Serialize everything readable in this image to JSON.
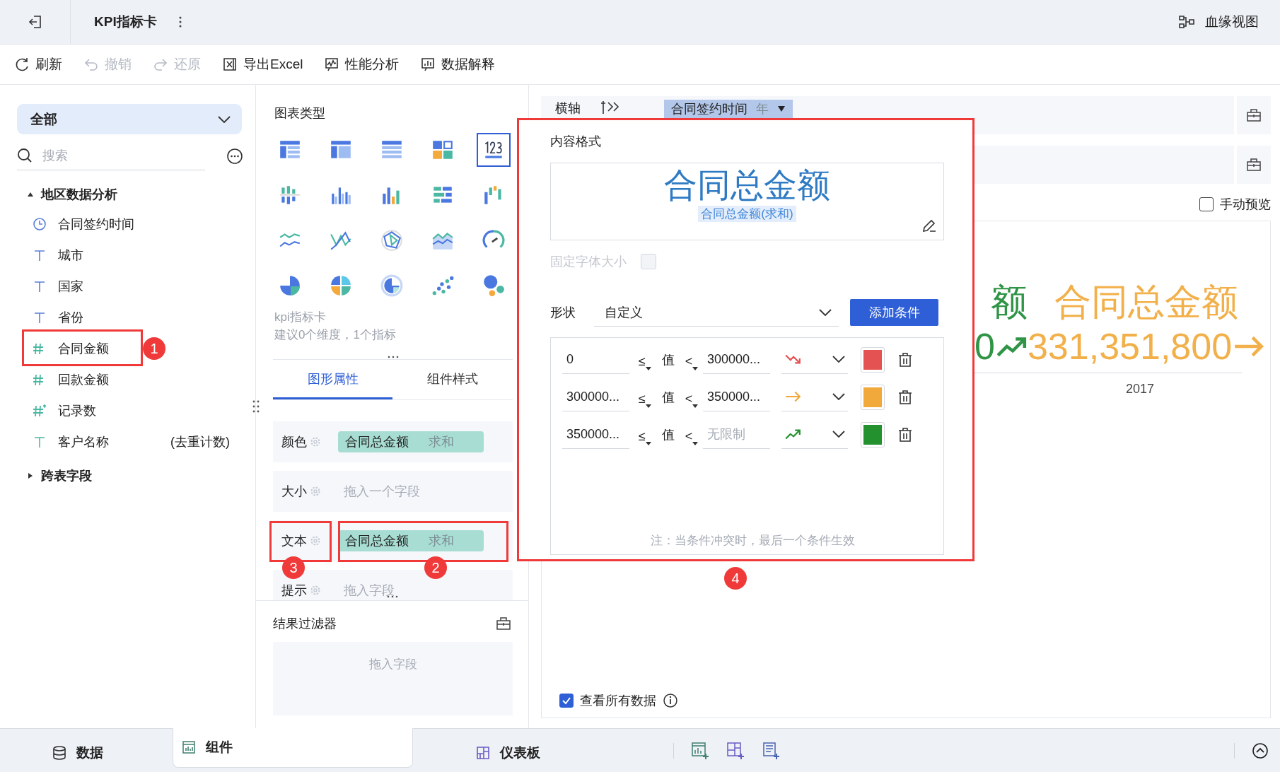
{
  "header": {
    "title": "KPI指标卡",
    "lineage_link": "血缘视图"
  },
  "toolbar": [
    {
      "kind": "refresh",
      "label": "刷新",
      "disabled": false
    },
    {
      "kind": "undo",
      "label": "撤销",
      "disabled": true
    },
    {
      "kind": "redo",
      "label": "还原",
      "disabled": true
    },
    {
      "kind": "export",
      "label": "导出Excel",
      "disabled": false
    },
    {
      "kind": "performance",
      "label": "性能分析",
      "disabled": false
    },
    {
      "kind": "explain",
      "label": "数据解释",
      "disabled": false
    }
  ],
  "data_panel": {
    "dataset_selector": "全部",
    "search": {
      "placeholder": "搜索"
    },
    "tree": [
      {
        "label": "地区数据分析",
        "expanded": true,
        "children": [
          {
            "kind": "date",
            "label": "合同签约时间"
          },
          {
            "kind": "text",
            "label": "城市"
          },
          {
            "kind": "text",
            "label": "国家"
          },
          {
            "kind": "text",
            "label": "省份"
          },
          {
            "kind": "measure",
            "label": "合同金额"
          },
          {
            "kind": "measure",
            "label": "回款金额"
          },
          {
            "kind": "count",
            "label": "记录数"
          },
          {
            "kind": "distinct",
            "label": "客户名称",
            "note": "(去重计数)"
          }
        ]
      },
      {
        "label": "跨表字段",
        "expanded": false
      }
    ]
  },
  "chart_types": {
    "title": "图表类型",
    "types": [
      {
        "kind": "table",
        "selected": false
      },
      {
        "kind": "cross-table",
        "selected": false
      },
      {
        "kind": "detail-table",
        "selected": false
      },
      {
        "kind": "block",
        "selected": false
      },
      {
        "kind": "kpi",
        "selected": true
      },
      {
        "kind": "grouped-bar",
        "selected": false
      },
      {
        "kind": "multi-bar",
        "selected": false
      },
      {
        "kind": "bar",
        "selected": false
      },
      {
        "kind": "hbar",
        "selected": false
      },
      {
        "kind": "waterfall",
        "selected": false
      },
      {
        "kind": "line",
        "selected": false
      },
      {
        "kind": "multi-line",
        "selected": false
      },
      {
        "kind": "radar",
        "selected": false
      },
      {
        "kind": "area",
        "selected": false
      },
      {
        "kind": "gauge",
        "selected": false
      },
      {
        "kind": "pie",
        "selected": false
      },
      {
        "kind": "rose",
        "selected": false
      },
      {
        "kind": "ring",
        "selected": false
      },
      {
        "kind": "scatter",
        "selected": false
      },
      {
        "kind": "bubble",
        "selected": false
      }
    ],
    "selected_name": "kpi指标卡",
    "hint": "建议0个维度，1个指标"
  },
  "property_tabs": [
    {
      "label": "图形属性",
      "selected": true
    },
    {
      "label": "组件样式",
      "selected": false
    }
  ],
  "properties": [
    {
      "label": "颜色",
      "field": "合同总金额",
      "aggregation": "求和"
    },
    {
      "label": "大小",
      "placeholder": "拖入一个字段"
    },
    {
      "label": "文本",
      "field": "合同总金额",
      "aggregation": "求和"
    },
    {
      "label": "提示",
      "placeholder": "拖入字段"
    }
  ],
  "result_filter": {
    "title": "结果过滤器",
    "placeholder": "拖入字段"
  },
  "axis_rows": [
    {
      "label": "横轴",
      "field": "合同签约时间",
      "aggregation": "年"
    }
  ],
  "manual_preview": {
    "label": "手动预览",
    "checked": false
  },
  "kpi_cards": [
    {
      "title": "额",
      "value": "0",
      "kind": "up",
      "color": "#2f9446"
    },
    {
      "title": "合同总金额",
      "value": "331,351,800",
      "kind": "flat",
      "color": "#f2b04a"
    }
  ],
  "x_axis_label": "2017",
  "view_all_data": {
    "label": "查看所有数据",
    "checked": true
  },
  "bottom_tabs": [
    {
      "kind": "data",
      "label": "数据",
      "selected": false
    },
    {
      "kind": "component",
      "label": "组件",
      "selected": true
    },
    {
      "kind": "dashboard",
      "label": "仪表板",
      "selected": false
    }
  ],
  "content_format": {
    "title": "内容格式",
    "preview_title": "合同总金额",
    "preview_field": "合同总金额(求和)",
    "fixed_font_size": {
      "label": "固定字体大小",
      "checked": false,
      "disabled": true
    },
    "shape": {
      "label": "形状",
      "value": "自定义"
    },
    "add_button": "添加条件",
    "conditions": [
      {
        "min": "0",
        "op1": "≤",
        "value_label": "值",
        "op2": "<",
        "max": "300000...",
        "kind": "down",
        "color": "#e45252"
      },
      {
        "min": "300000...",
        "op1": "≤",
        "value_label": "值",
        "op2": "<",
        "max": "350000...",
        "kind": "flat",
        "color": "#f0a93a"
      },
      {
        "min": "350000...",
        "op1": "≤",
        "value_label": "值",
        "op2": "<",
        "max_placeholder": "无限制",
        "kind": "up",
        "color": "#24912f"
      }
    ],
    "note": "注：当条件冲突时，最后一个条件生效"
  },
  "annotations": [
    {
      "label": "1"
    },
    {
      "label": "3"
    },
    {
      "label": "2"
    },
    {
      "label": "4"
    }
  ]
}
